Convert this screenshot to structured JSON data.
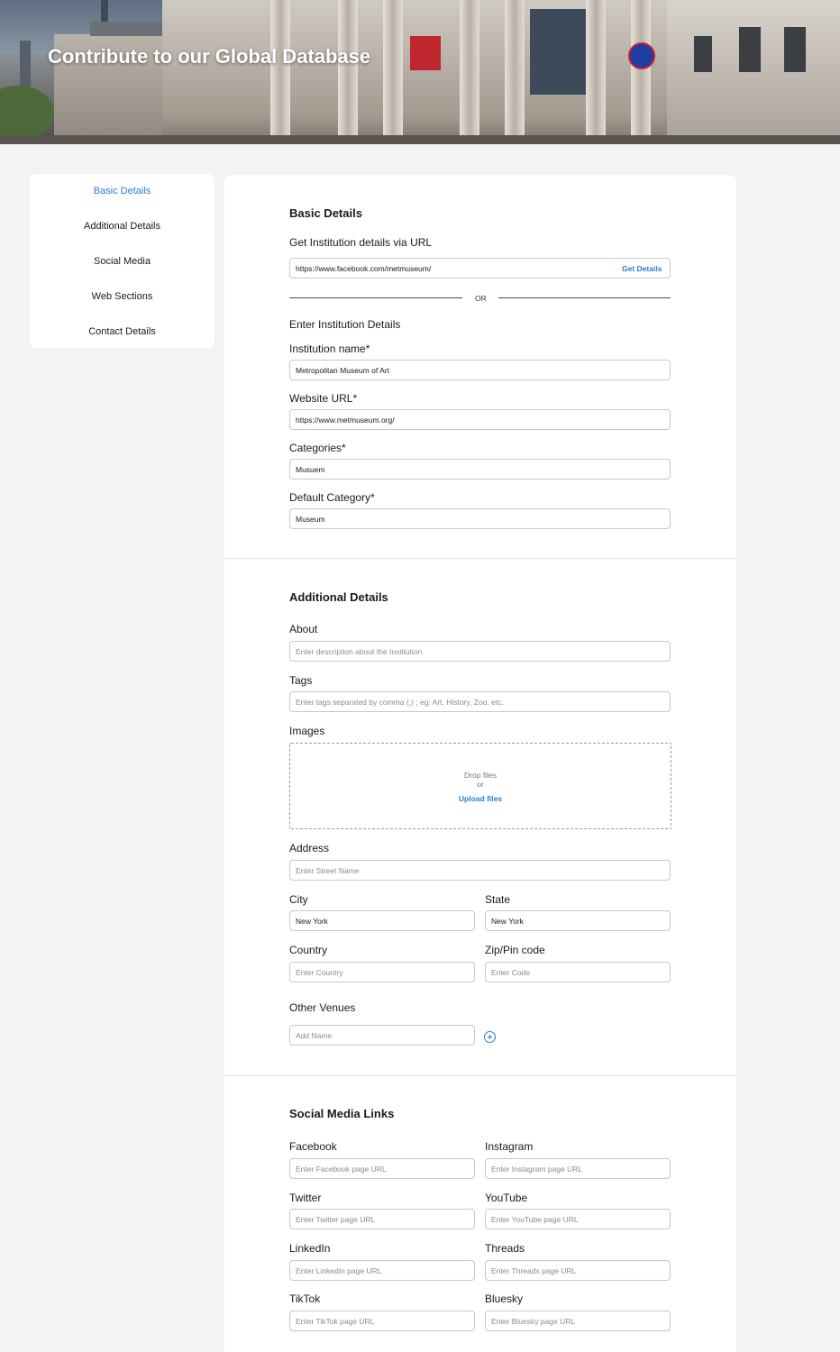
{
  "hero": {
    "title": "Contribute to our Global Database"
  },
  "sidebar": {
    "items": [
      {
        "label": "Basic Details",
        "active": true
      },
      {
        "label": "Additional Details"
      },
      {
        "label": "Social Media"
      },
      {
        "label": "Web Sections"
      },
      {
        "label": "Contact Details"
      }
    ]
  },
  "basic": {
    "heading": "Basic Details",
    "via_url_label": "Get Institution details via URL",
    "via_url_value": "https://www.facebook.com/metmuseum/",
    "get_details_label": "Get Details",
    "or_label": "OR",
    "enter_label": "Enter Institution Details",
    "name_label": "Institution name*",
    "name_value": "Metropolitan Museum of Art",
    "website_label": "Website URL*",
    "website_value": "https://www.metmuseum.org/",
    "categories_label": "Categories*",
    "categories_value": "Musuem",
    "default_category_label": "Default Category*",
    "default_category_value": "Museum"
  },
  "additional": {
    "heading": "Additional Details",
    "about_label": "About",
    "about_placeholder": "Enter description about the Institution",
    "tags_label": "Tags",
    "tags_placeholder": "Enter tags separated by comma (,) ; eg: Art, History, Zoo, etc.",
    "images_label": "Images",
    "drop_text": "Drop files",
    "or_text": "or",
    "upload_link": "Upload files",
    "address_label": "Address",
    "address_placeholder": "Enter Street Name",
    "city_label": "City",
    "city_value": "New York",
    "state_label": "State",
    "state_value": "New York",
    "country_label": "Country",
    "country_placeholder": "Enter Country",
    "zip_label": "Zip/Pin code",
    "zip_placeholder": "Enter Code",
    "venues_label": "Other Venues",
    "venues_placeholder": "Add Name"
  },
  "social": {
    "heading": "Social Media Links",
    "facebook_label": "Facebook",
    "facebook_placeholder": "Enter Facebook page URL",
    "instagram_label": "Instagram",
    "instagram_placeholder": "Enter Instagram page URL",
    "twitter_label": "Twitter",
    "twitter_placeholder": "Enter Twitter page URL",
    "youtube_label": "YouTube",
    "youtube_placeholder": "Enter YouTube page URL",
    "linkedin_label": "LinkedIn",
    "linkedin_placeholder": "Enter LinkedIn page URL",
    "threads_label": "Threads",
    "threads_placeholder": "Enter Threads page URL",
    "tiktok_label": "TikTok",
    "tiktok_placeholder": "Enter TikTok page URL",
    "bluesky_label": "Bluesky",
    "bluesky_placeholder": "Enter Bluesky page URL"
  },
  "colors": {
    "accent": "#2f7bd6",
    "page_bg": "#f3f3f3",
    "card_bg": "#ffffff"
  }
}
